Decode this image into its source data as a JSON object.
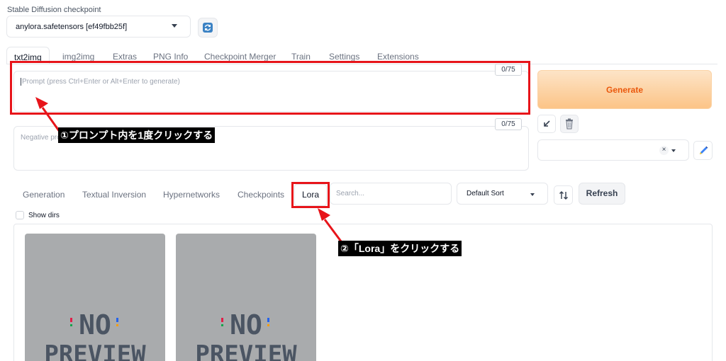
{
  "checkpoint": {
    "label": "Stable Diffusion checkpoint",
    "value": "anylora.safetensors [ef49fbb25f]"
  },
  "main_tabs": [
    "txt2img",
    "img2img",
    "Extras",
    "PNG Info",
    "Checkpoint Merger",
    "Train",
    "Settings",
    "Extensions"
  ],
  "prompt": {
    "placeholder": "Prompt (press Ctrl+Enter or Alt+Enter to generate)",
    "counter": "0/75"
  },
  "negative_prompt": {
    "placeholder": "Negative pro",
    "counter": "0/75"
  },
  "generate_label": "Generate",
  "extra_tabs": [
    "Generation",
    "Textual Inversion",
    "Hypernetworks",
    "Checkpoints",
    "Lora"
  ],
  "search_placeholder": "Search...",
  "sort_value": "Default Sort",
  "refresh_label": "Refresh",
  "show_dirs_label": "Show dirs",
  "cards": [
    {
      "line1": "NO",
      "line2": "PREVIEW"
    },
    {
      "line1": "NO",
      "line2": "PREVIEW"
    }
  ],
  "annotations": {
    "step1": "①プロンプト内を1度クリックする",
    "step2": "②「Lora」をクリックする"
  },
  "colors": {
    "annotation_red": "#e7141a",
    "generate_text": "#ea580c",
    "generate_bg": "#fcc487"
  }
}
